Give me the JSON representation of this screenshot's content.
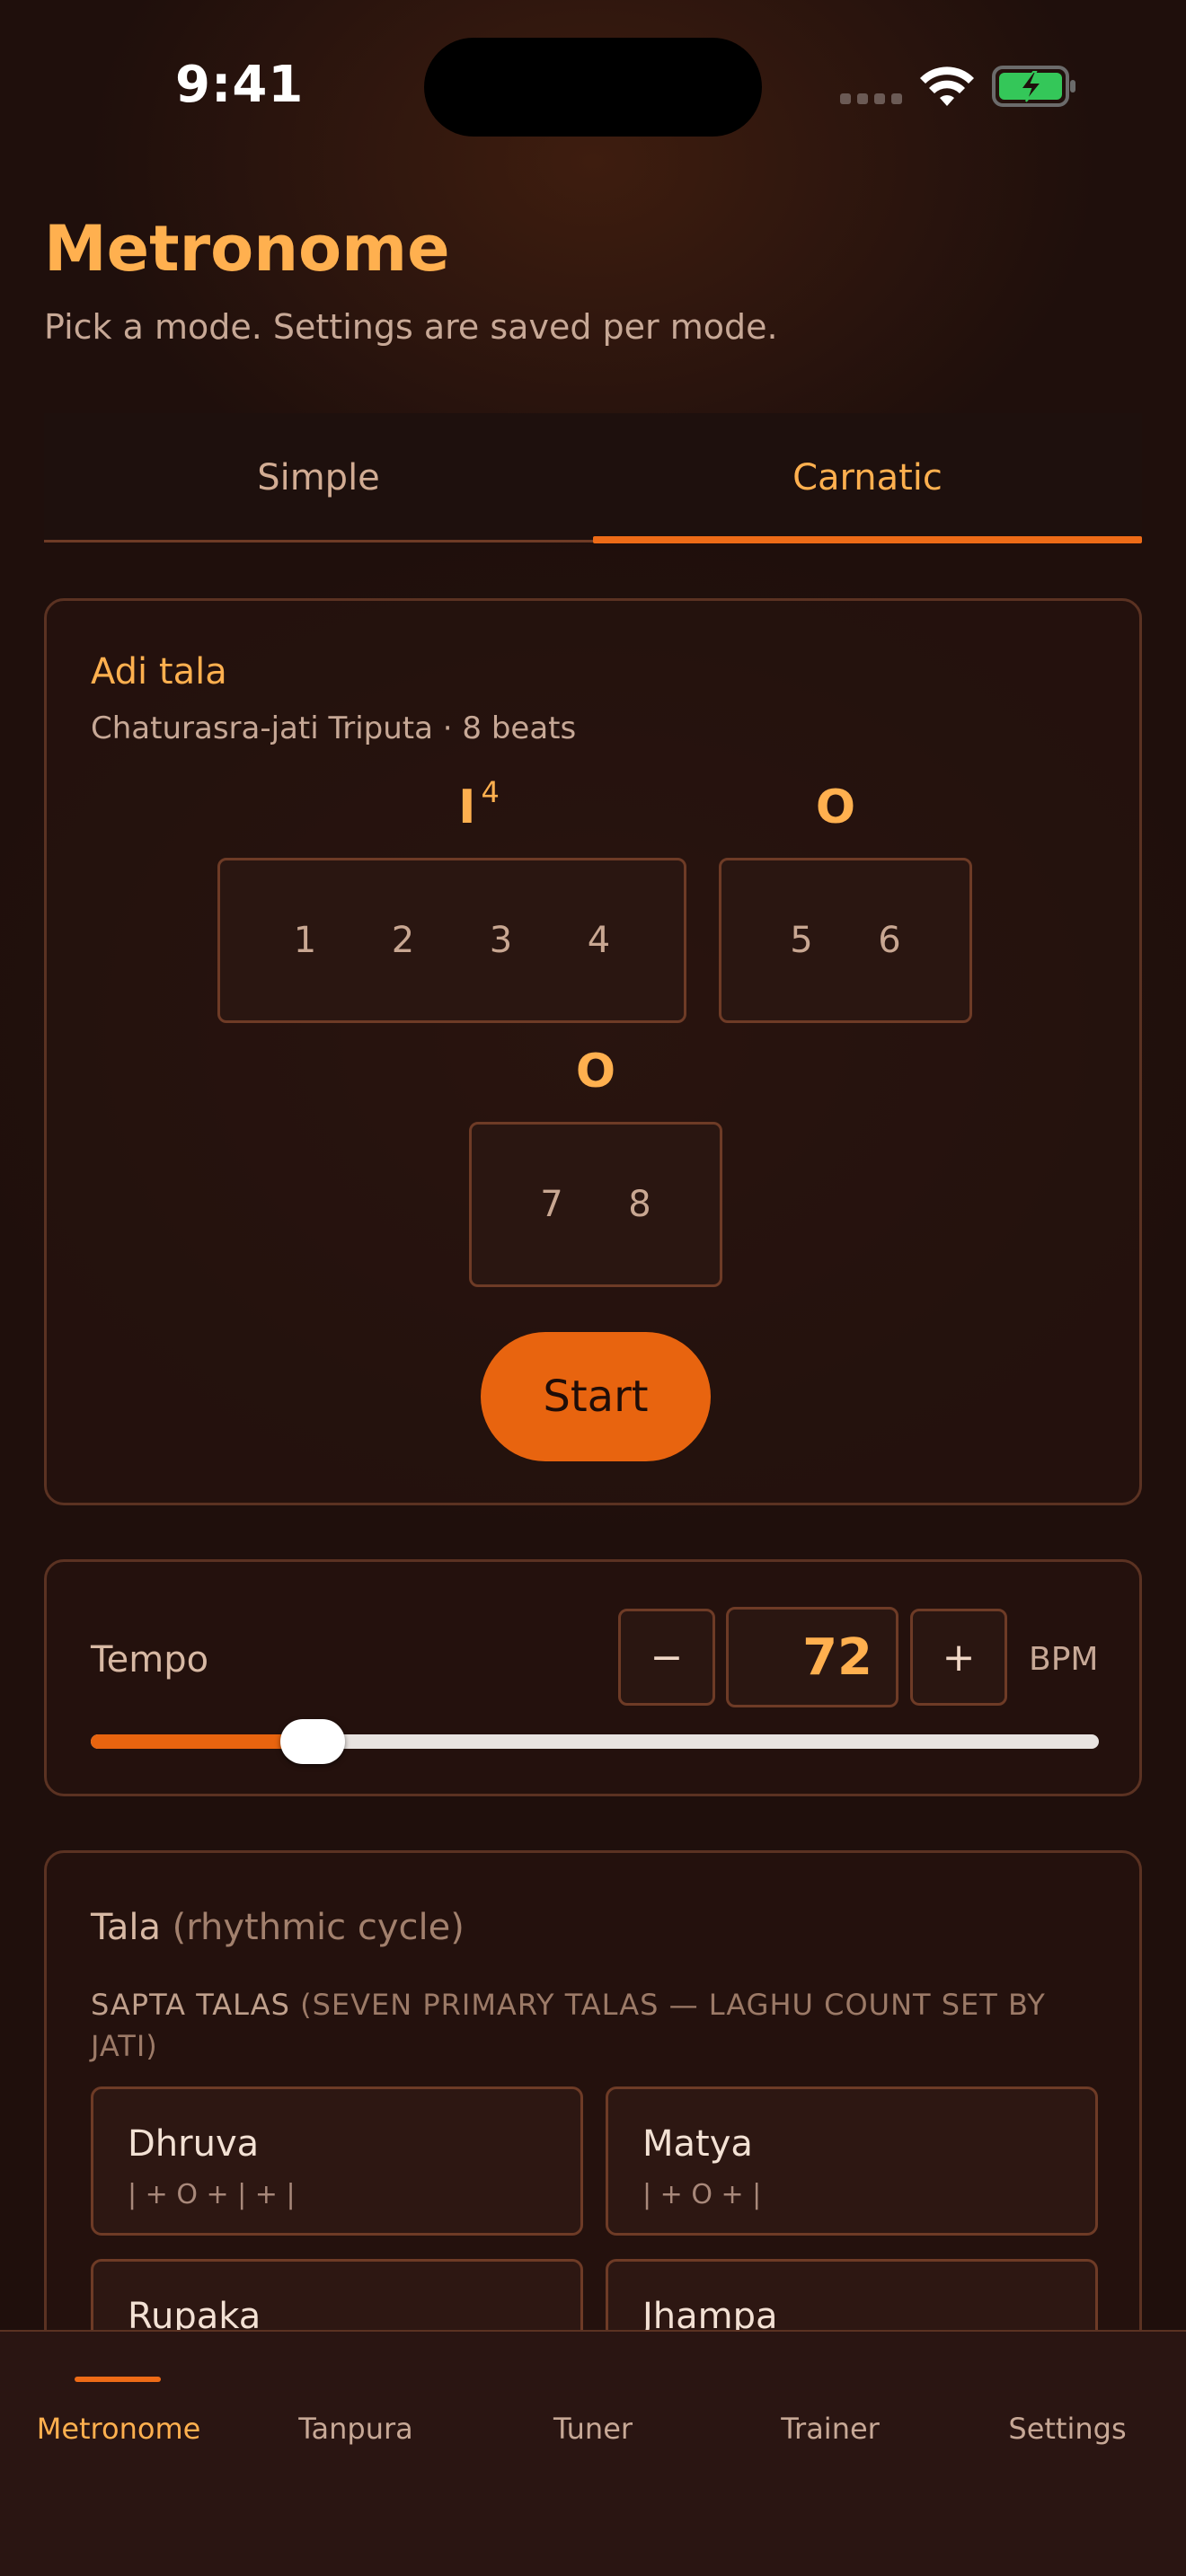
{
  "status_bar": {
    "time": "9:41"
  },
  "header": {
    "title": "Metronome",
    "subtitle": "Pick a mode. Settings are saved per mode."
  },
  "mode_tabs": [
    {
      "label": "Simple",
      "selected": false
    },
    {
      "label": "Carnatic",
      "selected": true
    }
  ],
  "tala_card": {
    "name": "Adi tala",
    "description": "Chaturasra-jati Triputa · 8 beats",
    "angas": [
      {
        "symbol": "I",
        "superscript": "4",
        "beats": [
          "1",
          "2",
          "3",
          "4"
        ]
      },
      {
        "symbol": "O",
        "superscript": "",
        "beats": [
          "5",
          "6"
        ]
      },
      {
        "symbol": "O",
        "superscript": "",
        "beats": [
          "7",
          "8"
        ]
      }
    ],
    "start_label": "Start"
  },
  "tempo": {
    "label": "Tempo",
    "decrement_label": "−",
    "increment_label": "+",
    "value": "72",
    "unit": "BPM",
    "slider_fraction": 0.22
  },
  "tala_list": {
    "title": "Tala",
    "title_note": "(rhythmic cycle)",
    "section_label": "SAPTA TALAS",
    "section_note": "(SEVEN PRIMARY TALAS — LAGHU COUNT SET BY JATI)",
    "options": [
      {
        "name": "Dhruva",
        "pattern": "| + O + | + |"
      },
      {
        "name": "Matya",
        "pattern": "| + O + |"
      },
      {
        "name": "Rupaka",
        "pattern": ""
      },
      {
        "name": "Jhampa",
        "pattern": ""
      }
    ]
  },
  "bottom_nav": [
    {
      "label": "Metronome",
      "active": true
    },
    {
      "label": "Tanpura",
      "active": false
    },
    {
      "label": "Tuner",
      "active": false
    },
    {
      "label": "Trainer",
      "active": false
    },
    {
      "label": "Settings",
      "active": false
    }
  ],
  "colors": {
    "accent": "#e8640f",
    "accent_text": "#ffb04f",
    "background": "#1f0f0c",
    "card_border": "#5b3222"
  }
}
